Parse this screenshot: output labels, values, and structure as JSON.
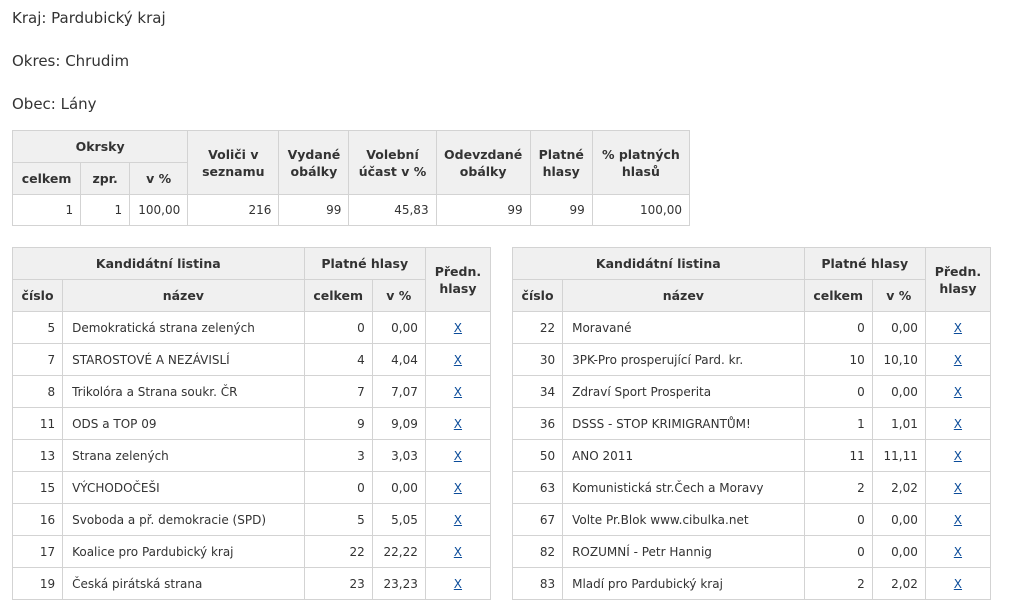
{
  "header": {
    "kraj": "Kraj: Pardubický kraj",
    "okres": "Okres: Chrudim",
    "obec": "Obec: Lány"
  },
  "summary": {
    "headers": {
      "okrsky": "Okrsky",
      "celkem": "celkem",
      "zpr": "zpr.",
      "v_pct": "v %",
      "volici": "Voliči v seznamu",
      "vydane": "Vydané obálky",
      "ucast": "Volební účast v %",
      "odevzdane": "Odevzdané obálky",
      "platne": "Platné hlasy",
      "pct_platnych": "% platných hlasů"
    },
    "values": {
      "celkem": "1",
      "zpr": "1",
      "v_pct": "100,00",
      "volici": "216",
      "vydane": "99",
      "ucast": "45,83",
      "odevzdane": "99",
      "platne": "99",
      "pct_platnych": "100,00"
    }
  },
  "party_headers": {
    "kandidatni_listina": "Kandidátní listina",
    "platne_hlasy": "Platné hlasy",
    "predn_hlasy": "Předn. hlasy",
    "cislo": "číslo",
    "nazev": "název",
    "celkem": "celkem",
    "v_pct": "v %"
  },
  "parties_left": [
    {
      "cislo": "5",
      "nazev": "Demokratická strana zelených",
      "celkem": "0",
      "pct": "0,00",
      "link": "X"
    },
    {
      "cislo": "7",
      "nazev": "STAROSTOVÉ A NEZÁVISLÍ",
      "celkem": "4",
      "pct": "4,04",
      "link": "X"
    },
    {
      "cislo": "8",
      "nazev": "Trikolóra a Strana soukr. ČR",
      "celkem": "7",
      "pct": "7,07",
      "link": "X"
    },
    {
      "cislo": "11",
      "nazev": "ODS a TOP 09",
      "celkem": "9",
      "pct": "9,09",
      "link": "X"
    },
    {
      "cislo": "13",
      "nazev": "Strana zelených",
      "celkem": "3",
      "pct": "3,03",
      "link": "X"
    },
    {
      "cislo": "15",
      "nazev": "VÝCHODOČEŠI",
      "celkem": "0",
      "pct": "0,00",
      "link": "X"
    },
    {
      "cislo": "16",
      "nazev": "Svoboda a př. demokracie (SPD)",
      "celkem": "5",
      "pct": "5,05",
      "link": "X"
    },
    {
      "cislo": "17",
      "nazev": "Koalice pro Pardubický kraj",
      "celkem": "22",
      "pct": "22,22",
      "link": "X"
    },
    {
      "cislo": "19",
      "nazev": "Česká pirátská strana",
      "celkem": "23",
      "pct": "23,23",
      "link": "X"
    }
  ],
  "parties_right": [
    {
      "cislo": "22",
      "nazev": "Moravané",
      "celkem": "0",
      "pct": "0,00",
      "link": "X"
    },
    {
      "cislo": "30",
      "nazev": "3PK-Pro prosperující Pard. kr.",
      "celkem": "10",
      "pct": "10,10",
      "link": "X"
    },
    {
      "cislo": "34",
      "nazev": "Zdraví Sport Prosperita",
      "celkem": "0",
      "pct": "0,00",
      "link": "X"
    },
    {
      "cislo": "36",
      "nazev": "DSSS - STOP KRIMIGRANTŮM!",
      "celkem": "1",
      "pct": "1,01",
      "link": "X"
    },
    {
      "cislo": "50",
      "nazev": "ANO 2011",
      "celkem": "11",
      "pct": "11,11",
      "link": "X"
    },
    {
      "cislo": "63",
      "nazev": "Komunistická str.Čech a Moravy",
      "celkem": "2",
      "pct": "2,02",
      "link": "X"
    },
    {
      "cislo": "67",
      "nazev": "Volte Pr.Blok www.cibulka.net",
      "celkem": "0",
      "pct": "0,00",
      "link": "X"
    },
    {
      "cislo": "82",
      "nazev": "ROZUMNÍ - Petr Hannig",
      "celkem": "0",
      "pct": "0,00",
      "link": "X"
    },
    {
      "cislo": "83",
      "nazev": "Mladí pro Pardubický kraj",
      "celkem": "2",
      "pct": "2,02",
      "link": "X"
    }
  ],
  "colors": {
    "header_bg": "#f0f0f0",
    "border": "#d3d3d3",
    "link": "#0b4c9a",
    "text": "#333333"
  }
}
